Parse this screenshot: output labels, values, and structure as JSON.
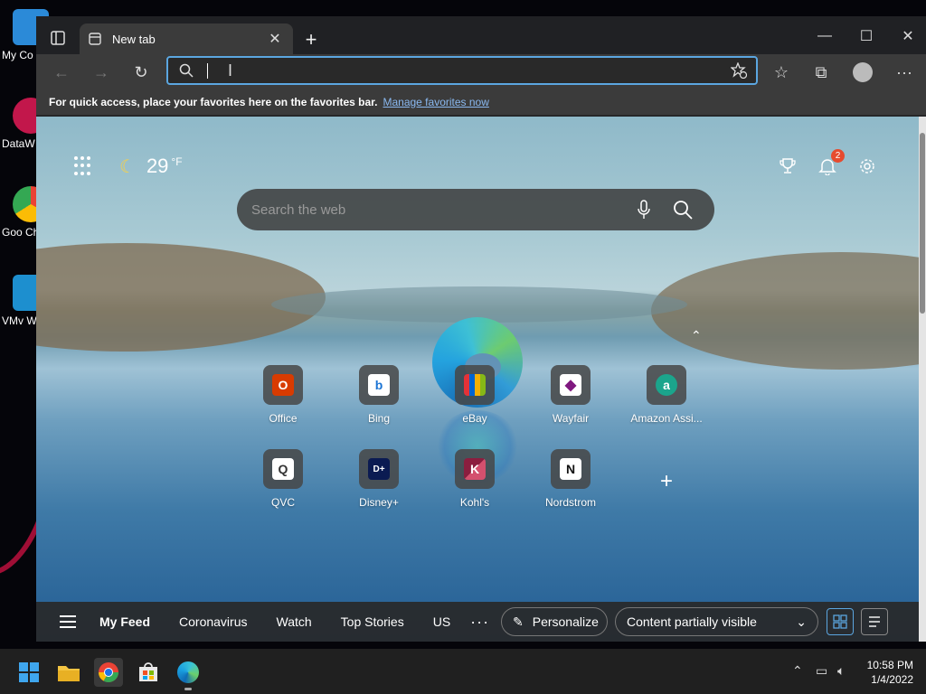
{
  "desktop": {
    "icons": [
      {
        "label": "My Co",
        "color": "#2b8ad8"
      },
      {
        "label": "DataW",
        "color": "#c2174b"
      },
      {
        "label": "Goo Chro",
        "color": "#1a73e8"
      },
      {
        "label": "VMv Works",
        "color": "#1d8fcf"
      }
    ]
  },
  "browser": {
    "tab": {
      "title": "New tab",
      "close_icon": "close-icon"
    },
    "new_tab_symbol": "+",
    "window_controls": {
      "minimize": "—",
      "maximize": "☐",
      "close": "✕"
    },
    "address": {
      "value": "",
      "placeholder": ""
    },
    "favorites_bar": {
      "message": "For quick access, place your favorites here on the favorites bar.",
      "link": "Manage favorites now"
    }
  },
  "newtab": {
    "weather": {
      "temp": "29",
      "unit": "°F"
    },
    "notifications_count": "2",
    "search": {
      "placeholder": "Search the web"
    },
    "tiles_row1": [
      {
        "label": "Office",
        "bg": "#d83b01",
        "glyph": "O"
      },
      {
        "label": "Bing",
        "bg": "#ffffff",
        "glyph": "b"
      },
      {
        "label": "eBay",
        "bg": "#111111",
        "glyph": "e"
      },
      {
        "label": "Wayfair",
        "bg": "#ffffff",
        "glyph": "◆"
      },
      {
        "label": "Amazon Assi...",
        "bg": "#1ba58c",
        "glyph": "a"
      }
    ],
    "tiles_row2": [
      {
        "label": "QVC",
        "bg": "#ffffff",
        "glyph": "Q"
      },
      {
        "label": "Disney+",
        "bg": "#0b1b52",
        "glyph": "D+"
      },
      {
        "label": "Kohl's",
        "bg": "#6a1b3a",
        "glyph": "K"
      },
      {
        "label": "Nordstrom",
        "bg": "#ffffff",
        "glyph": "N"
      }
    ],
    "add_tile_symbol": "+",
    "feed": {
      "tabs": [
        "My Feed",
        "Coronavirus",
        "Watch",
        "Top Stories",
        "US"
      ],
      "more": "···",
      "personalize": "Personalize",
      "visibility": "Content partially visible"
    }
  },
  "taskbar": {
    "time": "10:58 PM",
    "date": "1/4/2022"
  },
  "colors": {
    "accent": "#5ba6e0",
    "badge": "#e64b2f",
    "link": "#8ab9f1"
  }
}
